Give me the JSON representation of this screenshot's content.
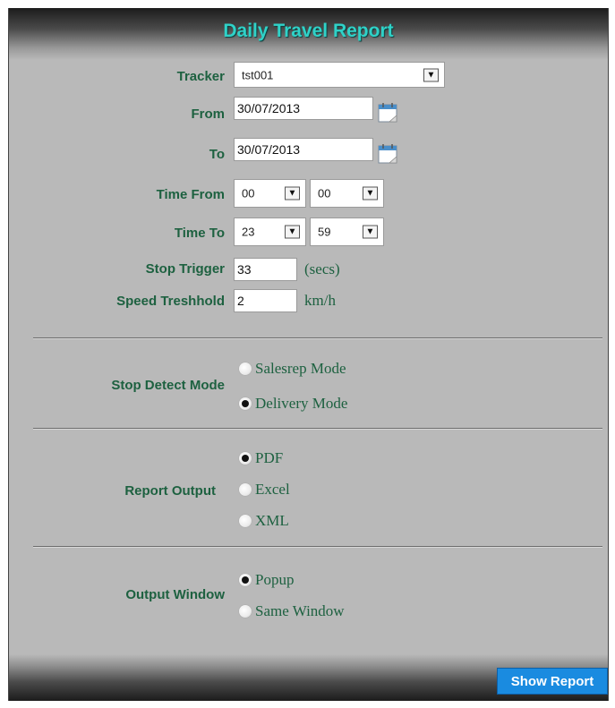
{
  "title": "Daily Travel Report",
  "tracker": {
    "label": "Tracker",
    "value": "tst001"
  },
  "from": {
    "label": "From",
    "value": "30/07/2013"
  },
  "to": {
    "label": "To",
    "value": "30/07/2013"
  },
  "time_from": {
    "label": "Time From",
    "hour": "00",
    "minute": "00"
  },
  "time_to": {
    "label": "Time To",
    "hour": "23",
    "minute": "59"
  },
  "stop_trigger": {
    "label": "Stop Trigger",
    "value": "33",
    "unit": "(secs)"
  },
  "speed_threshold": {
    "label": "Speed Treshhold",
    "value": "2",
    "unit": "km/h"
  },
  "stop_detect_mode": {
    "label": "Stop Detect Mode",
    "options": [
      {
        "label": "Salesrep Mode",
        "checked": false
      },
      {
        "label": "Delivery Mode",
        "checked": true
      }
    ]
  },
  "report_output": {
    "label": "Report Output",
    "options": [
      {
        "label": "PDF",
        "checked": true
      },
      {
        "label": "Excel",
        "checked": false
      },
      {
        "label": "XML",
        "checked": false
      }
    ]
  },
  "output_window": {
    "label": "Output Window",
    "options": [
      {
        "label": "Popup",
        "checked": true
      },
      {
        "label": "Same Window",
        "checked": false
      }
    ]
  },
  "show_report_label": "Show Report",
  "colors": {
    "title": "#2fd2c8",
    "label": "#1d6140",
    "button": "#1a8be0",
    "panel": "#b9b9b9"
  }
}
